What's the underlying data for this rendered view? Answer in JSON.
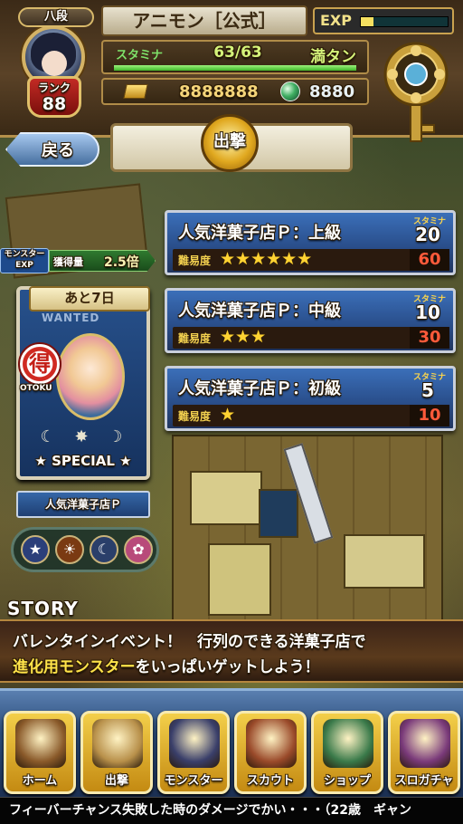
{
  "player": {
    "title_badge": "八段",
    "rank_label": "ランク",
    "rank": "88",
    "username": "アニモン［公式］",
    "exp_label": "EXP",
    "exp_fraction": 0.15
  },
  "stamina": {
    "label": "スタミナ",
    "value": "63/63",
    "status": "満タン",
    "fraction": 1.0
  },
  "currency": {
    "gold": "8888888",
    "orbs": "8880"
  },
  "nav_top": {
    "back_label": "戻る",
    "sortie_label": "出撃"
  },
  "stages": [
    {
      "name": "人気洋菓子店Ｐ：上級",
      "stamina_label": "スタミナ",
      "cost": "20",
      "difficulty_label": "難易度",
      "stars": 6,
      "reward": "60"
    },
    {
      "name": "人気洋菓子店Ｐ：中級",
      "stamina_label": "スタミナ",
      "cost": "10",
      "difficulty_label": "難易度",
      "stars": 3,
      "reward": "30"
    },
    {
      "name": "人気洋菓子店Ｐ：初級",
      "stamina_label": "スタミナ",
      "cost": "5",
      "difficulty_label": "難易度",
      "stars": 1,
      "reward": "10"
    }
  ],
  "exp_bonus": {
    "icon_text": "モンスターEXP",
    "label": "獲得量",
    "value": "2.5倍"
  },
  "event_card": {
    "days_left": "あと7日",
    "wanted": "WANTED",
    "toku": "得",
    "toku_caption": "OTOKU",
    "symbols": "☾ ✸ ☽",
    "special": "★ SPECIAL ★",
    "event_name": "人気洋菓子店Ｐ"
  },
  "attributes": [
    {
      "name": "star",
      "glyph": "★",
      "color": "#2b3f7a"
    },
    {
      "name": "sun",
      "glyph": "☀",
      "color": "#7a3a12"
    },
    {
      "name": "moon",
      "glyph": "☾",
      "color": "#2a3f6a"
    },
    {
      "name": "flower",
      "glyph": "✿",
      "color": "#b84a7a"
    }
  ],
  "story": {
    "title": "STORY",
    "line1": "バレンタインイベント！　行列のできる洋菓子店で",
    "line2_highlight": "進化用モンスター",
    "line2_rest": "をいっぱいゲットしよう！"
  },
  "bottom_nav": [
    {
      "label": "ホーム",
      "color": "#8a5a2a"
    },
    {
      "label": "出撃",
      "color": "#b8904a"
    },
    {
      "label": "モンスター",
      "color": "#3a3f6a"
    },
    {
      "label": "スカウト",
      "color": "#9a4a2a"
    },
    {
      "label": "ショップ",
      "color": "#3a7a4a"
    },
    {
      "label": "スロガチャ",
      "color": "#7a3a7a"
    }
  ],
  "ticker": "フィーバーチャンス失敗した時のダメージでかい・・・（22歳　ギャン"
}
